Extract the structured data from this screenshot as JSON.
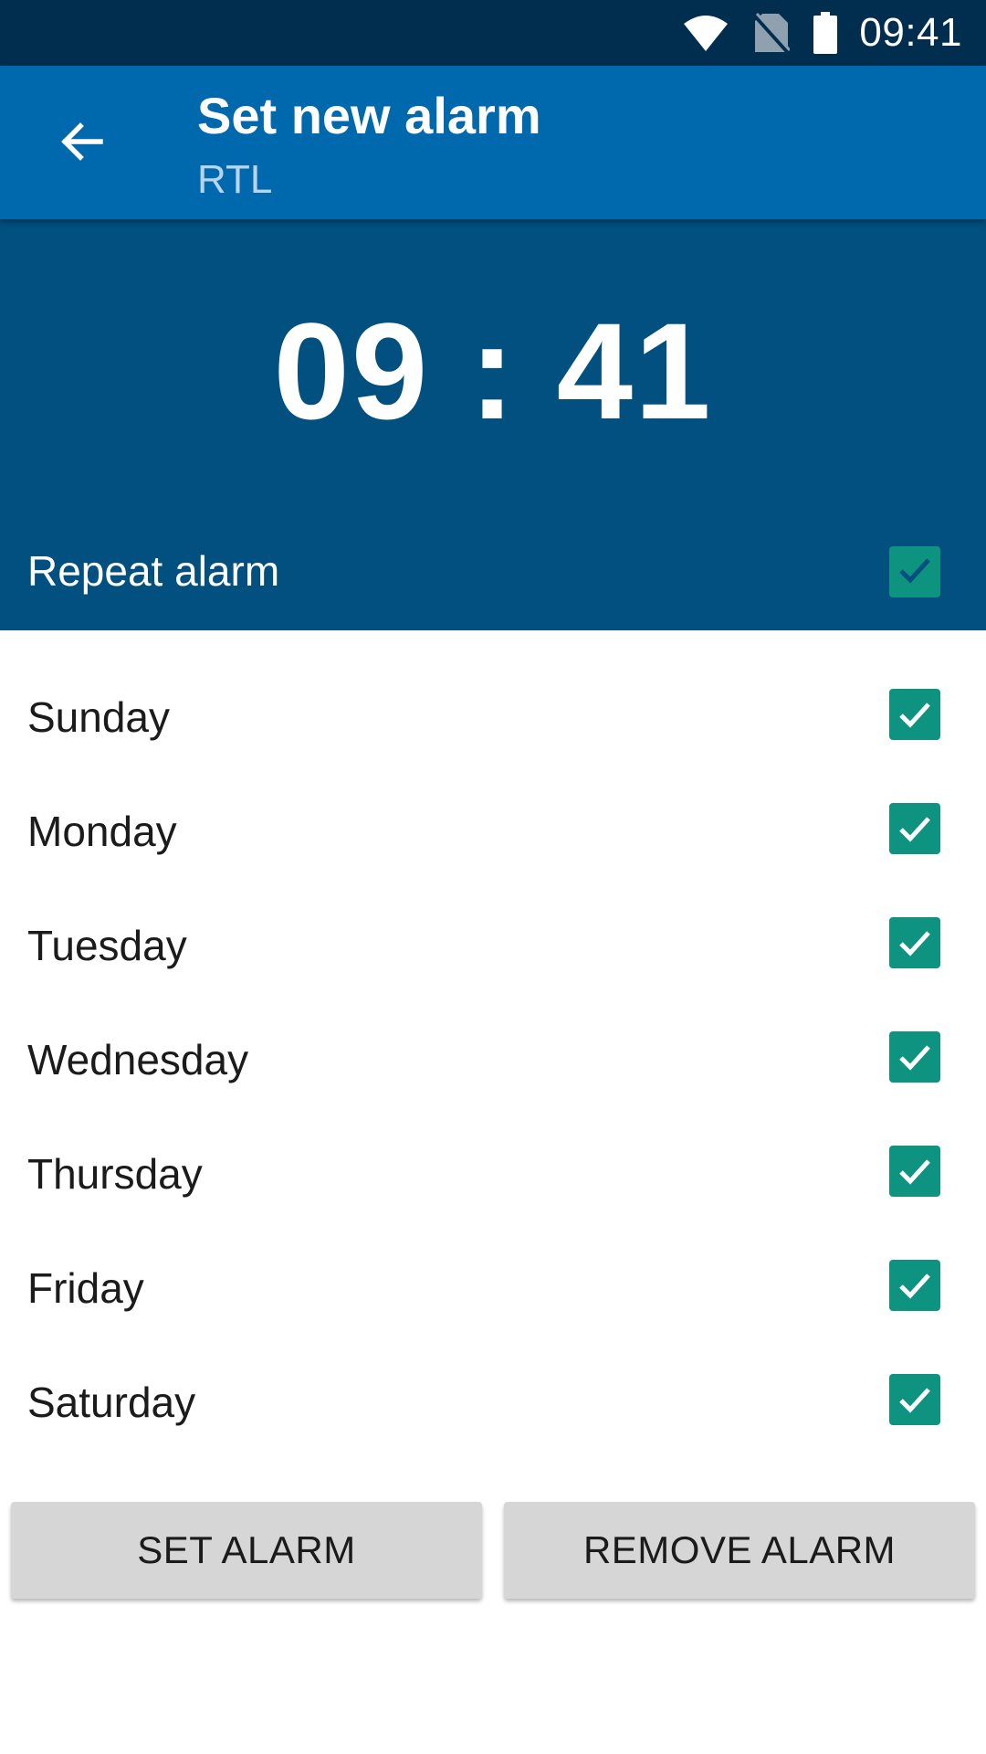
{
  "status_bar": {
    "time": "09:41",
    "icons": [
      "wifi-icon",
      "no-sim-icon",
      "battery-icon"
    ]
  },
  "app_bar": {
    "back_icon": "arrow-left-icon",
    "title": "Set new alarm",
    "subtitle": "RTL"
  },
  "alarm": {
    "hour": "09",
    "separator": ":",
    "minute": "41",
    "repeat_label": "Repeat alarm",
    "repeat_checked": true
  },
  "days": [
    {
      "label": "Sunday",
      "checked": true
    },
    {
      "label": "Monday",
      "checked": true
    },
    {
      "label": "Tuesday",
      "checked": true
    },
    {
      "label": "Wednesday",
      "checked": true
    },
    {
      "label": "Thursday",
      "checked": true
    },
    {
      "label": "Friday",
      "checked": true
    },
    {
      "label": "Saturday",
      "checked": true
    }
  ],
  "buttons": {
    "set_label": "SET ALARM",
    "remove_label": "REMOVE ALARM"
  },
  "colors": {
    "status_bar": "#012e4f",
    "app_bar": "#0069ad",
    "header_panel": "#01507f",
    "checkbox": "#0e9381",
    "button": "#d6d6d6"
  }
}
